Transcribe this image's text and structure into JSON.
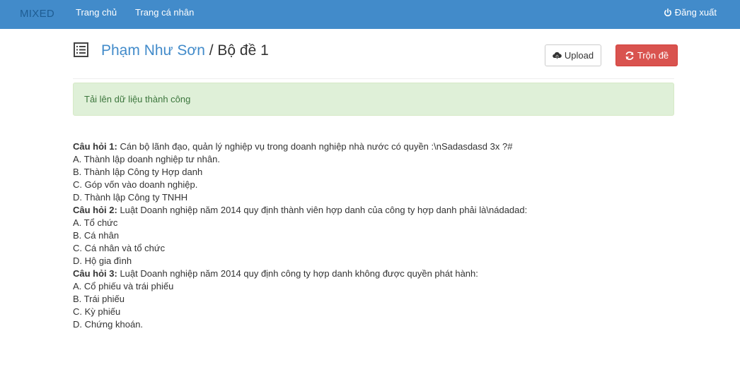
{
  "navbar": {
    "brand": "MIXED",
    "links": [
      "Trang chủ",
      "Trang cá nhân"
    ],
    "logout_label": "Đăng xuất"
  },
  "header": {
    "author": "Phạm Như Sơn",
    "separator": " / ",
    "set_name": "Bộ đề 1"
  },
  "toolbar": {
    "upload_label": "Upload",
    "shuffle_label": "Trộn đề"
  },
  "alert": {
    "message": "Tải lên dữ liệu thành công"
  },
  "questions": [
    {
      "label": "Câu hỏi 1:",
      "text": " Cán bộ lãnh đạo, quản lý nghiệp vụ trong doanh nghiệp nhà nước có quyền :\\nSadasdasd 3x ?#",
      "answers": [
        "A. Thành lập doanh nghiệp tư nhân.",
        "B. Thành lập Công ty Hợp danh",
        "C. Góp vốn vào doanh nghiệp.",
        "D. Thành lập Công ty TNHH"
      ]
    },
    {
      "label": "Câu hỏi 2:",
      "text": " Luật Doanh nghiệp năm 2014 quy định thành viên hợp danh của công ty hợp danh phải là\\nádadad:",
      "answers": [
        "A. Tổ chức",
        "B. Cá nhân",
        "C. Cá nhân và tổ chức",
        "D. Hộ gia đình"
      ]
    },
    {
      "label": "Câu hỏi 3:",
      "text": " Luật Doanh nghiệp năm 2014 quy định công ty hợp danh không được quyền phát hành:",
      "answers": [
        "A. Cổ phiếu và trái phiếu",
        "B. Trái phiếu",
        "C. Kỳ phiếu",
        "D. Chứng khoán."
      ]
    }
  ],
  "colors": {
    "navbar": "#428bca",
    "brand": "#1f5d93",
    "link": "#428bca",
    "danger": "#d9534f",
    "alert_bg": "#dff0d8",
    "alert_text": "#3c763d"
  },
  "icons": {
    "logout": "power-icon",
    "title": "list-icon",
    "upload": "cloud-upload-icon",
    "shuffle": "refresh-icon"
  }
}
